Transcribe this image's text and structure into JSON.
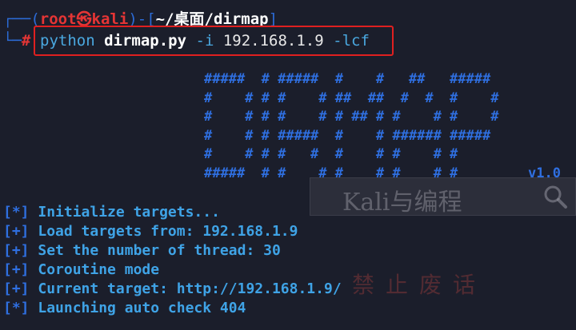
{
  "prompt": {
    "corner_top": "┌──(",
    "user": "root",
    "skull": "㉿",
    "host": "kali",
    "sep": ")-[",
    "path": "~/桌面/dirmap",
    "close": "]",
    "corner_bottom": "└─",
    "hash": "#"
  },
  "command": {
    "program": "python",
    "script": "dirmap.py",
    "flag_i": "-i",
    "target": "192.168.1.9",
    "flag_lcf": "-lcf"
  },
  "banner": {
    "lines": [
      "#####  # #####  #    #   ##   #####",
      "#    # # #    # ##  ##  #  #  #    #",
      "#    # # #    # # ## # #    # #    #",
      "#    # # #####  #    # ###### #####",
      "#    # # #   #  #    # #    # #",
      "#####  # #    # #    # #    # #"
    ],
    "version": "v1.0"
  },
  "output": [
    {
      "marker": "[*]",
      "text": "Initialize targets..."
    },
    {
      "marker": "[+]",
      "text": "Load targets from: 192.168.1.9"
    },
    {
      "marker": "[+]",
      "text": "Set the number of thread: 30"
    },
    {
      "marker": "[+]",
      "text": "Coroutine mode"
    },
    {
      "marker": "[+]",
      "text": "Current target: http://192.168.1.9/"
    },
    {
      "marker": "[*]",
      "text": "Launching auto check 404"
    }
  ],
  "watermark": {
    "search_text": "Kali与编程",
    "seal_text": "禁止废话",
    "search_icon": "search-icon"
  },
  "colors": {
    "background": "#1b1e2b",
    "prompt_blue": "#2c6bd6",
    "root_red": "#e53535",
    "output_cyan": "#3fa3e6",
    "highlight_box": "#e02020"
  }
}
